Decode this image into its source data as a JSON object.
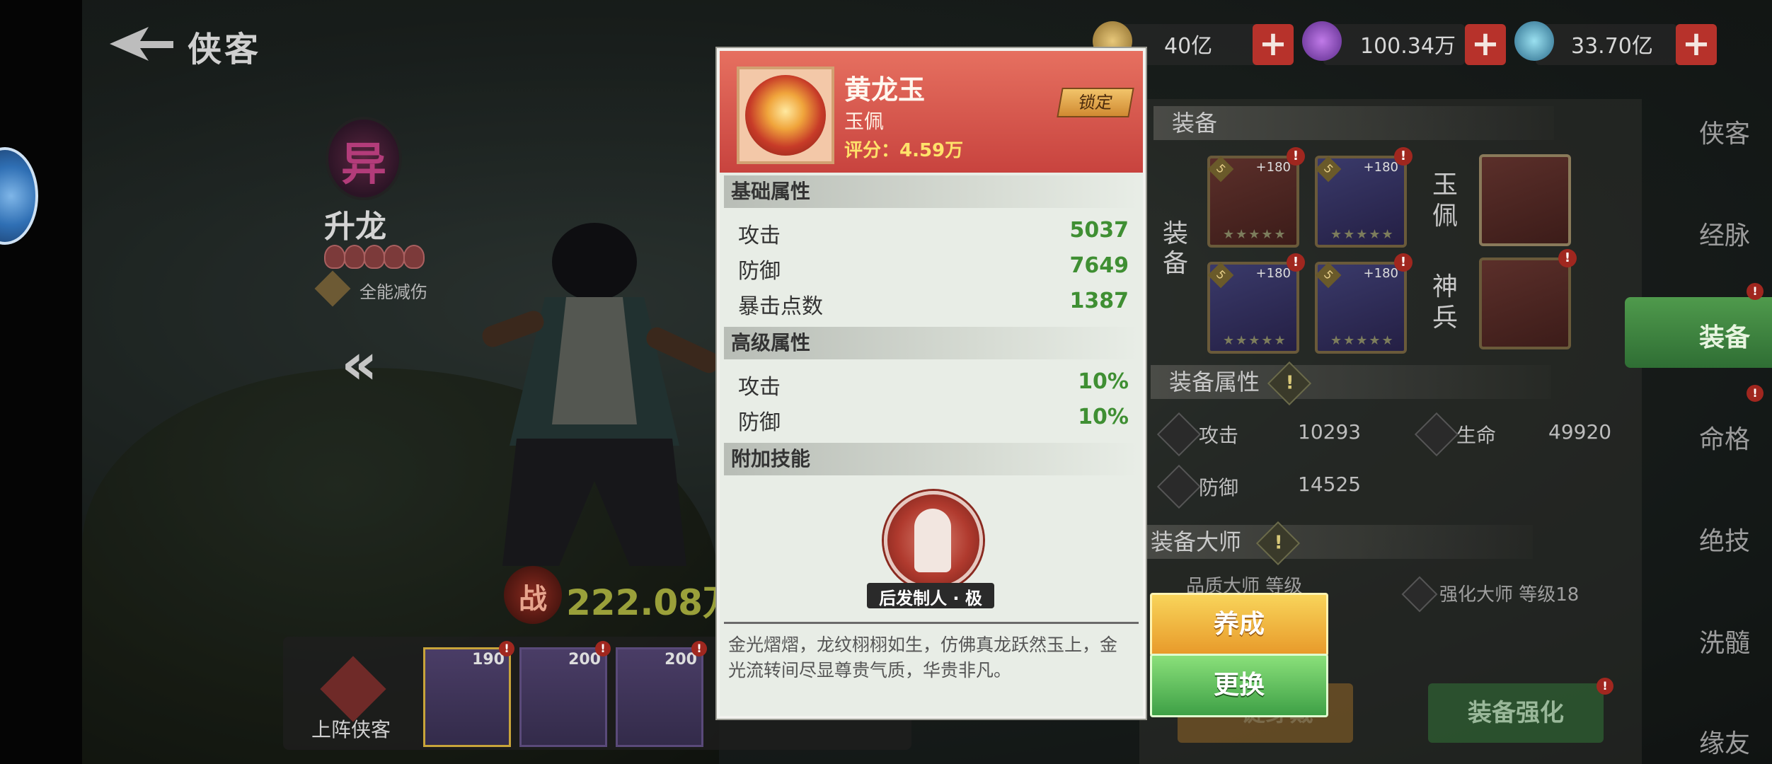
{
  "header": {
    "title": "侠客",
    "currencies": [
      {
        "icon": "gold-coin-icon",
        "value": "40亿"
      },
      {
        "icon": "purple-gem-icon",
        "value": "100.34万"
      },
      {
        "icon": "blue-orb-icon",
        "value": "33.70亿"
      }
    ]
  },
  "hero": {
    "emblem_glyph": "异",
    "name": "升龙",
    "stars": 5,
    "skill_label": "全能减伤",
    "power_icon_glyph": "战",
    "power": "222.08万"
  },
  "hero_bar": {
    "deploy_label": "上阵侠客",
    "cards": [
      {
        "level": "190",
        "badge": "!"
      },
      {
        "level": "200",
        "badge": "!"
      },
      {
        "level": "200",
        "badge": "!"
      },
      {
        "level": "",
        "badge": ""
      },
      {
        "level": "",
        "badge": ""
      }
    ]
  },
  "equipment_panel": {
    "equip_header": "装备",
    "equip_side_label": "装备",
    "jade_label": "玉佩",
    "weapon_label": "神兵",
    "slots": [
      {
        "grade": "5",
        "plus": "+180",
        "badge": "!"
      },
      {
        "grade": "5",
        "plus": "+180",
        "badge": "!"
      },
      {
        "grade": "5",
        "plus": "+180",
        "badge": "!"
      },
      {
        "grade": "5",
        "plus": "+180",
        "badge": "!"
      }
    ],
    "attr_header": "装备属性",
    "attrs": [
      {
        "label": "攻击",
        "value": "10293"
      },
      {
        "label": "生命",
        "value": "49920"
      },
      {
        "label": "防御",
        "value": "14525"
      }
    ],
    "master_header": "装备大师",
    "master_left": "品质大师 等级",
    "master_right": "强化大师 等级18",
    "btn_oneclick": "一键穿戴",
    "btn_enhance": "装备强化"
  },
  "nav": {
    "items": [
      "侠客",
      "经脉",
      "装备",
      "命格",
      "绝技",
      "洗髓",
      "缘友"
    ],
    "active": "装备"
  },
  "popup": {
    "item_name": "黄龙玉",
    "item_type": "玉佩",
    "item_score": "评分：4.59万",
    "lock_label": "锁定",
    "basic_header": "基础属性",
    "basic_stats": [
      {
        "label": "攻击",
        "value": "5037"
      },
      {
        "label": "防御",
        "value": "7649"
      },
      {
        "label": "暴击点数",
        "value": "1387"
      }
    ],
    "advanced_header": "高级属性",
    "advanced_stats": [
      {
        "label": "攻击",
        "value": "10%"
      },
      {
        "label": "防御",
        "value": "10%"
      }
    ],
    "skill_header": "附加技能",
    "skill_name": "后发制人 · 极",
    "description": "金光熠熠，龙纹栩栩如生，仿佛真龙跃然玉上，金光流转间尽显尊贵气质，华贵非凡。"
  },
  "actions": {
    "cultivate": "养成",
    "replace": "更换"
  },
  "colors": {
    "popup_header": "#d9534a",
    "stat_green": "#3f8f33",
    "btn_yellow": "#f0b43a",
    "btn_green": "#5cc45a",
    "badge_red": "#a0271f"
  }
}
